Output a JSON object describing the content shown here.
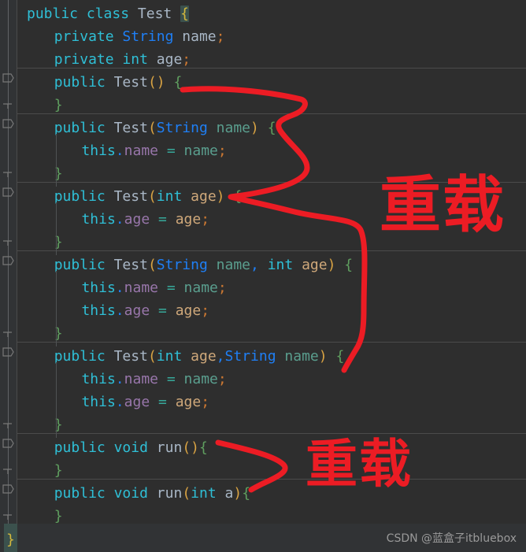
{
  "editor": {
    "theme": "darcula",
    "background": "#2e2e2e",
    "gutter_background": "#313335",
    "separator_color": "#4b4b4b",
    "language": "java",
    "class_name": "Test"
  },
  "colors": {
    "keyword": "#2fbfd6",
    "class_identifier": "#a9b7c6",
    "type_string": "#1f7ff5",
    "field": "#9876aa",
    "param_int": "#cfa87a",
    "param_string": "#5a9e8e",
    "operator": "#37a99b",
    "semicolon": "#cc7832",
    "paren": "#d9a343",
    "curly_brace": "#5f9e5f",
    "annotation_red": "#ec1c24",
    "watermark": "#9a9a9a"
  },
  "code_lines": [
    {
      "indent": 0,
      "tokens": [
        {
          "t": "public",
          "c": "kw"
        },
        {
          "t": " ",
          "c": "plain"
        },
        {
          "t": "class",
          "c": "kw"
        },
        {
          "t": " ",
          "c": "plain"
        },
        {
          "t": "Test",
          "c": "cls"
        },
        {
          "t": " ",
          "c": "plain"
        },
        {
          "t": "{",
          "c": "gold brace-hl"
        }
      ]
    },
    {
      "indent": 1,
      "tokens": [
        {
          "t": "private",
          "c": "kw"
        },
        {
          "t": " ",
          "c": "plain"
        },
        {
          "t": "String",
          "c": "type"
        },
        {
          "t": " ",
          "c": "plain"
        },
        {
          "t": "name",
          "c": "cls"
        },
        {
          "t": ";",
          "c": "semi"
        }
      ]
    },
    {
      "indent": 1,
      "tokens": [
        {
          "t": "private",
          "c": "kw"
        },
        {
          "t": " ",
          "c": "plain"
        },
        {
          "t": "int",
          "c": "kw"
        },
        {
          "t": " ",
          "c": "plain"
        },
        {
          "t": "age",
          "c": "cls"
        },
        {
          "t": ";",
          "c": "semi"
        }
      ]
    },
    {
      "indent": 1,
      "tokens": [
        {
          "t": "public",
          "c": "kw"
        },
        {
          "t": " ",
          "c": "plain"
        },
        {
          "t": "Test",
          "c": "cls"
        },
        {
          "t": "(",
          "c": "paren"
        },
        {
          "t": ")",
          "c": "paren"
        },
        {
          "t": " ",
          "c": "plain"
        },
        {
          "t": "{",
          "c": "brace"
        }
      ]
    },
    {
      "indent": 1,
      "tokens": [
        {
          "t": "}",
          "c": "brace"
        }
      ]
    },
    {
      "indent": 1,
      "tokens": [
        {
          "t": "public",
          "c": "kw"
        },
        {
          "t": " ",
          "c": "plain"
        },
        {
          "t": "Test",
          "c": "cls"
        },
        {
          "t": "(",
          "c": "paren"
        },
        {
          "t": "String",
          "c": "type"
        },
        {
          "t": " ",
          "c": "plain"
        },
        {
          "t": "name",
          "c": "prmg"
        },
        {
          "t": ")",
          "c": "paren"
        },
        {
          "t": " ",
          "c": "plain"
        },
        {
          "t": "{",
          "c": "brace"
        }
      ]
    },
    {
      "indent": 2,
      "tokens": [
        {
          "t": "this",
          "c": "kw"
        },
        {
          "t": ".",
          "c": "dot"
        },
        {
          "t": "name",
          "c": "fld"
        },
        {
          "t": " ",
          "c": "plain"
        },
        {
          "t": "=",
          "c": "op"
        },
        {
          "t": " ",
          "c": "plain"
        },
        {
          "t": "name",
          "c": "prmg"
        },
        {
          "t": ";",
          "c": "semi"
        }
      ]
    },
    {
      "indent": 1,
      "tokens": [
        {
          "t": "}",
          "c": "brace"
        }
      ]
    },
    {
      "indent": 1,
      "tokens": [
        {
          "t": "public",
          "c": "kw"
        },
        {
          "t": " ",
          "c": "plain"
        },
        {
          "t": "Test",
          "c": "cls"
        },
        {
          "t": "(",
          "c": "paren"
        },
        {
          "t": "int",
          "c": "kw"
        },
        {
          "t": " ",
          "c": "plain"
        },
        {
          "t": "age",
          "c": "prm"
        },
        {
          "t": ")",
          "c": "paren"
        },
        {
          "t": " ",
          "c": "plain"
        },
        {
          "t": "{",
          "c": "brace"
        }
      ]
    },
    {
      "indent": 2,
      "tokens": [
        {
          "t": "this",
          "c": "kw"
        },
        {
          "t": ".",
          "c": "dot"
        },
        {
          "t": "age",
          "c": "fld"
        },
        {
          "t": " ",
          "c": "plain"
        },
        {
          "t": "=",
          "c": "op"
        },
        {
          "t": " ",
          "c": "plain"
        },
        {
          "t": "age",
          "c": "prm"
        },
        {
          "t": ";",
          "c": "semi"
        }
      ]
    },
    {
      "indent": 1,
      "tokens": [
        {
          "t": "}",
          "c": "brace"
        }
      ]
    },
    {
      "indent": 1,
      "tokens": [
        {
          "t": "public",
          "c": "kw"
        },
        {
          "t": " ",
          "c": "plain"
        },
        {
          "t": "Test",
          "c": "cls"
        },
        {
          "t": "(",
          "c": "paren"
        },
        {
          "t": "String",
          "c": "type"
        },
        {
          "t": " ",
          "c": "plain"
        },
        {
          "t": "name",
          "c": "prmg"
        },
        {
          "t": ",",
          "c": "type"
        },
        {
          "t": " ",
          "c": "plain"
        },
        {
          "t": "int",
          "c": "kw"
        },
        {
          "t": " ",
          "c": "plain"
        },
        {
          "t": "age",
          "c": "prm"
        },
        {
          "t": ")",
          "c": "paren"
        },
        {
          "t": " ",
          "c": "plain"
        },
        {
          "t": "{",
          "c": "brace"
        }
      ]
    },
    {
      "indent": 2,
      "tokens": [
        {
          "t": "this",
          "c": "kw"
        },
        {
          "t": ".",
          "c": "dot"
        },
        {
          "t": "name",
          "c": "fld"
        },
        {
          "t": " ",
          "c": "plain"
        },
        {
          "t": "=",
          "c": "op"
        },
        {
          "t": " ",
          "c": "plain"
        },
        {
          "t": "name",
          "c": "prmg"
        },
        {
          "t": ";",
          "c": "semi"
        }
      ]
    },
    {
      "indent": 2,
      "tokens": [
        {
          "t": "this",
          "c": "kw"
        },
        {
          "t": ".",
          "c": "dot"
        },
        {
          "t": "age",
          "c": "fld"
        },
        {
          "t": " ",
          "c": "plain"
        },
        {
          "t": "=",
          "c": "op"
        },
        {
          "t": " ",
          "c": "plain"
        },
        {
          "t": "age",
          "c": "prm"
        },
        {
          "t": ";",
          "c": "semi"
        }
      ]
    },
    {
      "indent": 1,
      "tokens": [
        {
          "t": "}",
          "c": "brace"
        }
      ]
    },
    {
      "indent": 1,
      "tokens": [
        {
          "t": "public",
          "c": "kw"
        },
        {
          "t": " ",
          "c": "plain"
        },
        {
          "t": "Test",
          "c": "cls"
        },
        {
          "t": "(",
          "c": "paren"
        },
        {
          "t": "int",
          "c": "kw"
        },
        {
          "t": " ",
          "c": "plain"
        },
        {
          "t": "age",
          "c": "prm"
        },
        {
          "t": ",",
          "c": "type"
        },
        {
          "t": "String",
          "c": "type"
        },
        {
          "t": " ",
          "c": "plain"
        },
        {
          "t": "name",
          "c": "prmg"
        },
        {
          "t": ")",
          "c": "paren"
        },
        {
          "t": " ",
          "c": "plain"
        },
        {
          "t": "{",
          "c": "brace"
        }
      ]
    },
    {
      "indent": 2,
      "tokens": [
        {
          "t": "this",
          "c": "kw"
        },
        {
          "t": ".",
          "c": "dot"
        },
        {
          "t": "name",
          "c": "fld"
        },
        {
          "t": " ",
          "c": "plain"
        },
        {
          "t": "=",
          "c": "op"
        },
        {
          "t": " ",
          "c": "plain"
        },
        {
          "t": "name",
          "c": "prmg"
        },
        {
          "t": ";",
          "c": "semi"
        }
      ]
    },
    {
      "indent": 2,
      "tokens": [
        {
          "t": "this",
          "c": "kw"
        },
        {
          "t": ".",
          "c": "dot"
        },
        {
          "t": "age",
          "c": "fld"
        },
        {
          "t": " ",
          "c": "plain"
        },
        {
          "t": "=",
          "c": "op"
        },
        {
          "t": " ",
          "c": "plain"
        },
        {
          "t": "age",
          "c": "prm"
        },
        {
          "t": ";",
          "c": "semi"
        }
      ]
    },
    {
      "indent": 1,
      "tokens": [
        {
          "t": "}",
          "c": "brace"
        }
      ]
    },
    {
      "indent": 1,
      "tokens": [
        {
          "t": "public",
          "c": "kw"
        },
        {
          "t": " ",
          "c": "plain"
        },
        {
          "t": "void",
          "c": "kw"
        },
        {
          "t": " ",
          "c": "plain"
        },
        {
          "t": "run",
          "c": "cls"
        },
        {
          "t": "(",
          "c": "paren"
        },
        {
          "t": ")",
          "c": "paren"
        },
        {
          "t": "{",
          "c": "brace"
        }
      ]
    },
    {
      "indent": 1,
      "tokens": [
        {
          "t": "}",
          "c": "brace"
        }
      ]
    },
    {
      "indent": 1,
      "tokens": [
        {
          "t": "public",
          "c": "kw"
        },
        {
          "t": " ",
          "c": "plain"
        },
        {
          "t": "void",
          "c": "kw"
        },
        {
          "t": " ",
          "c": "plain"
        },
        {
          "t": "run",
          "c": "cls"
        },
        {
          "t": "(",
          "c": "paren"
        },
        {
          "t": "int",
          "c": "kw"
        },
        {
          "t": " ",
          "c": "plain"
        },
        {
          "t": "a",
          "c": "cls"
        },
        {
          "t": ")",
          "c": "paren"
        },
        {
          "t": "{",
          "c": "brace"
        }
      ]
    },
    {
      "indent": 1,
      "tokens": [
        {
          "t": "}",
          "c": "brace"
        }
      ]
    }
  ],
  "final_brace": "}",
  "annotations": [
    {
      "id": "label-1",
      "text": "重载",
      "color": "#ec1c24",
      "meaning": "overload (constructor overloading)"
    },
    {
      "id": "label-2",
      "text": "重载",
      "color": "#ec1c24",
      "meaning": "overload (method overloading)"
    }
  ],
  "watermark": {
    "text": "CSDN @蓝盒子itbluebox"
  }
}
